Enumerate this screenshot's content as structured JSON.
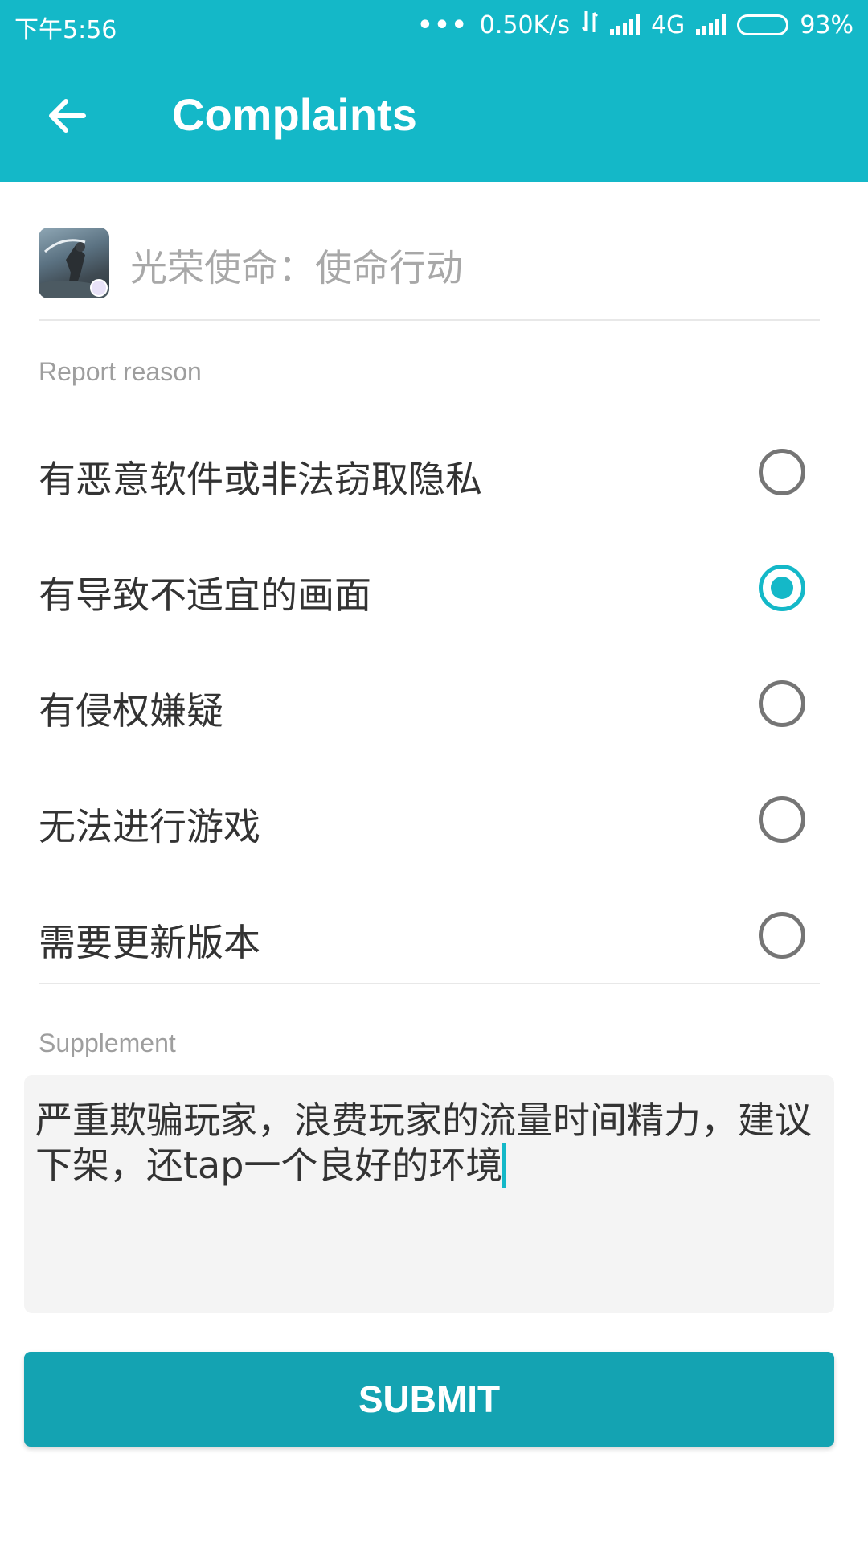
{
  "status_bar": {
    "time": "下午5:56",
    "dots": "•••",
    "speed": "0.50K/s",
    "network": "4G",
    "battery": "93%"
  },
  "app_bar": {
    "title": "Complaints",
    "back_icon": "arrow-left-icon"
  },
  "app": {
    "name": "光荣使命：使命行动"
  },
  "report": {
    "label": "Report reason",
    "options": [
      {
        "label": "有恶意软件或非法窃取隐私",
        "selected": false
      },
      {
        "label": "有导致不适宜的画面",
        "selected": true
      },
      {
        "label": "有侵权嫌疑",
        "selected": false
      },
      {
        "label": "无法进行游戏",
        "selected": false
      },
      {
        "label": "需要更新版本",
        "selected": false
      }
    ]
  },
  "supplement": {
    "label": "Supplement",
    "text": "严重欺骗玩家，浪费玩家的流量时间精力，建议下架，还tap一个良好的环境"
  },
  "submit_label": "SUBMIT",
  "colors": {
    "primary": "#14b8c8",
    "button": "#14a3b2"
  }
}
